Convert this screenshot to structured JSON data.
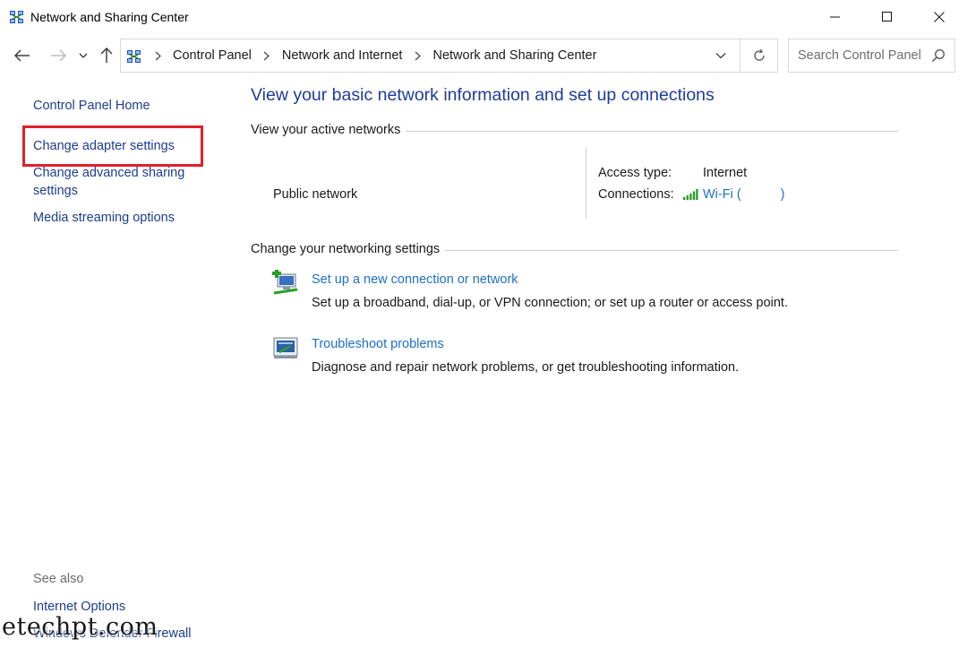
{
  "window": {
    "title": "Network and Sharing Center",
    "controls": [
      "minimize",
      "maximize",
      "close"
    ]
  },
  "navigation": {
    "breadcrumbs": [
      "Control Panel",
      "Network and Internet",
      "Network and Sharing Center"
    ],
    "search_placeholder": "Search Control Panel"
  },
  "left_pane": {
    "links": [
      "Control Panel Home",
      "Change adapter settings",
      "Change advanced sharing settings",
      "Media streaming options"
    ],
    "highlighted": "Change adapter settings",
    "see_also_title": "See also",
    "see_also_links": [
      "Internet Options",
      "Windows Defender Firewall"
    ]
  },
  "main": {
    "title": "View your basic network information and set up connections",
    "active_networks_header": "View your active networks",
    "network": {
      "name": "Public network",
      "access_type_label": "Access type:",
      "access_type_value": "Internet",
      "connections_label": "Connections:",
      "connection_name": "Wi-Fi (",
      "connection_close": ")"
    },
    "change_settings_header": "Change your networking settings",
    "tasks": [
      {
        "link": "Set up a new connection or network",
        "description": "Set up a broadband, dial-up, or VPN connection; or set up a router or access point.",
        "icon": "new-connection-icon"
      },
      {
        "link": "Troubleshoot problems",
        "description": "Diagnose and repair network problems, or get troubleshooting information.",
        "icon": "troubleshoot-icon"
      }
    ]
  },
  "watermark": "etechpt.com",
  "colors": {
    "link_blue": "#1e6fc8",
    "nav_link": "#1d3d8f",
    "title_blue": "#1e3c99",
    "highlight_red": "#e0202b",
    "wifi_green": "#2a9d2a"
  }
}
